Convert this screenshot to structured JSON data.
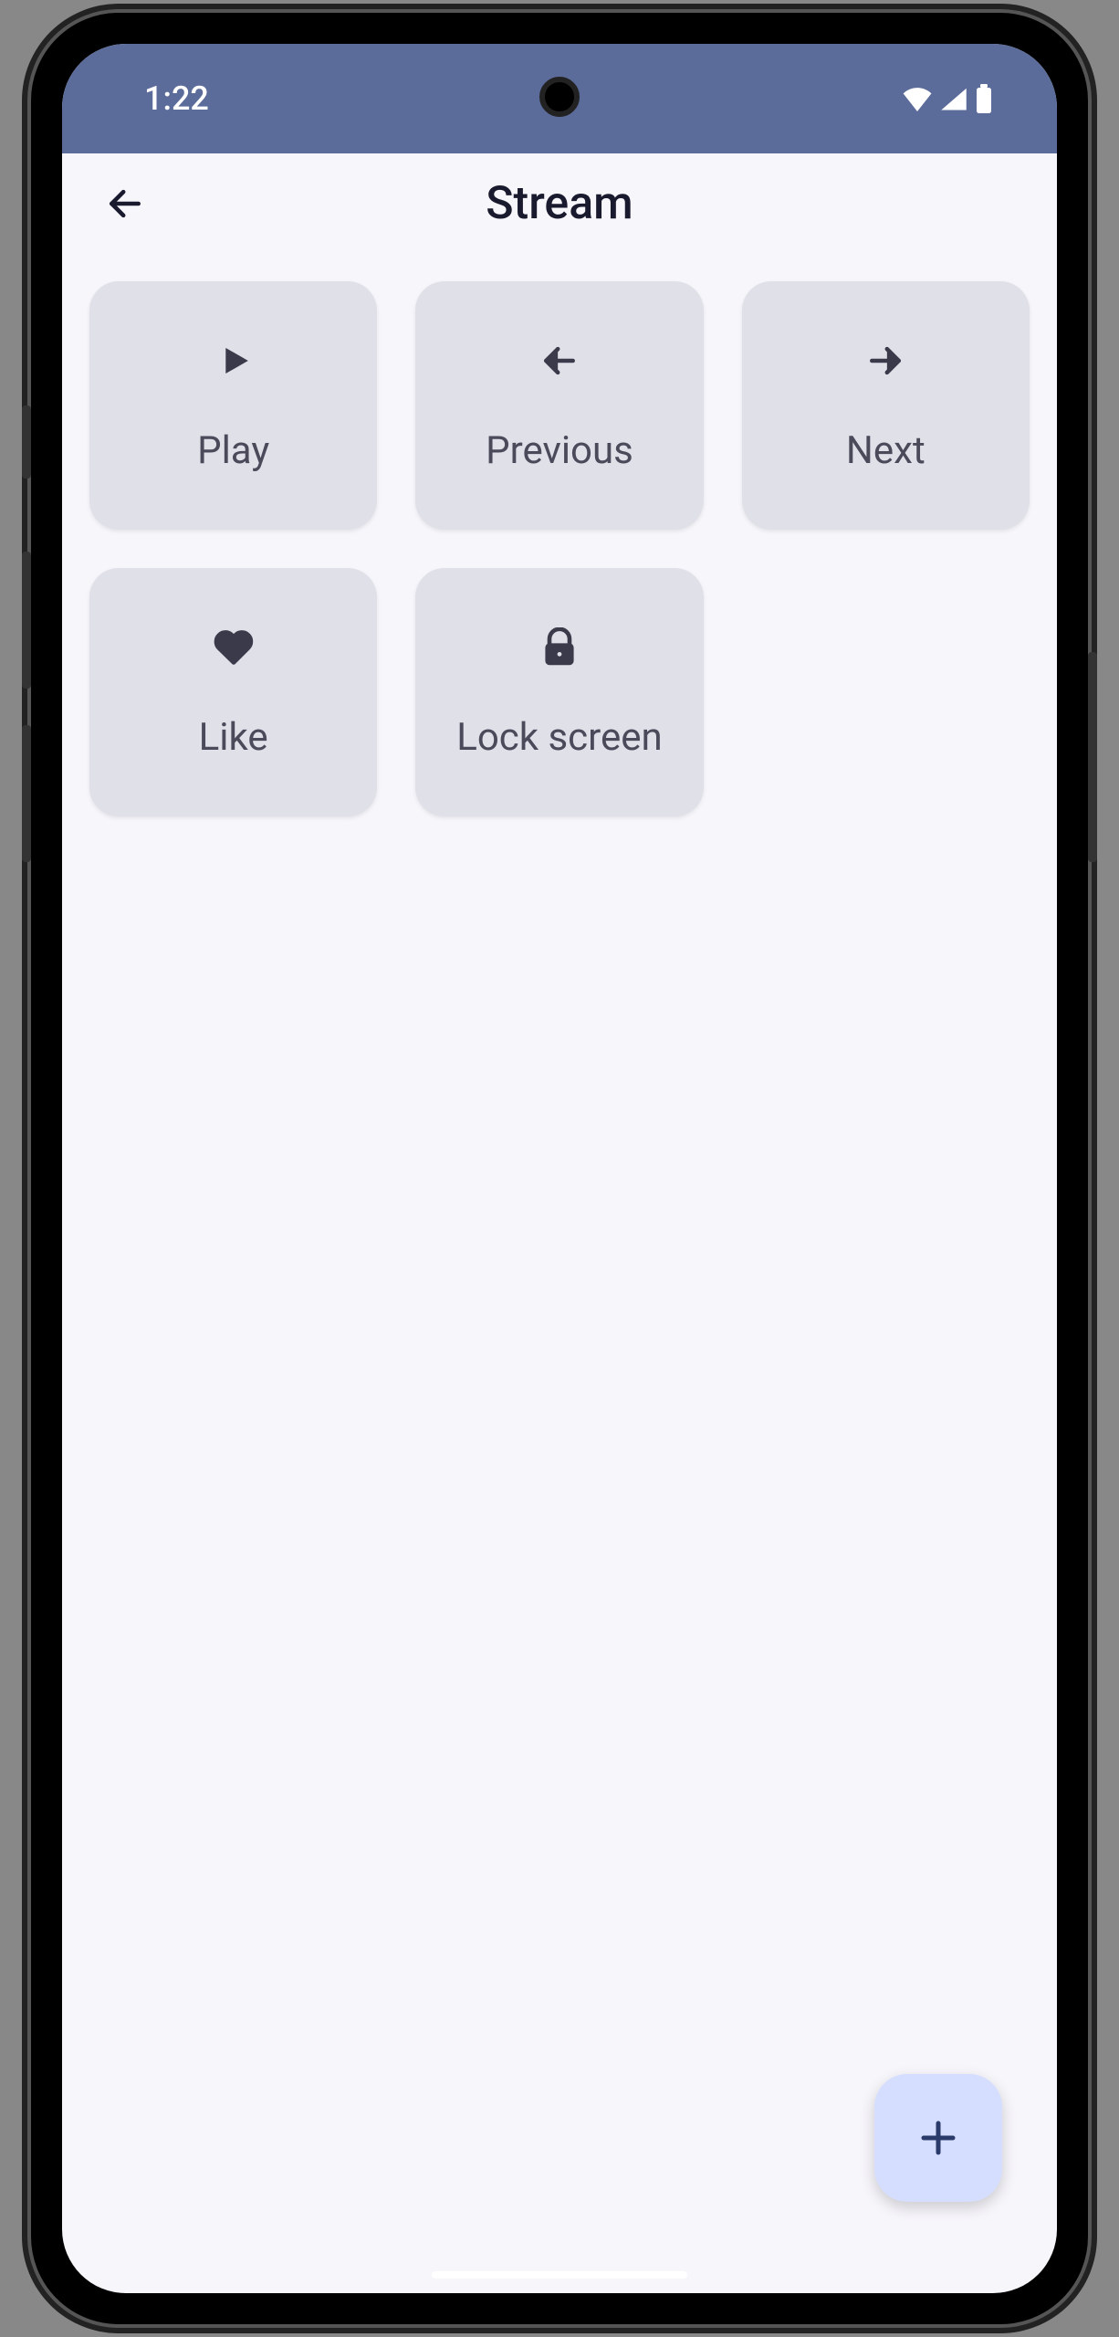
{
  "status": {
    "time": "1:22"
  },
  "header": {
    "title": "Stream"
  },
  "tiles": [
    {
      "label": "Play",
      "icon": "play-icon"
    },
    {
      "label": "Previous",
      "icon": "arrow-left-icon"
    },
    {
      "label": "Next",
      "icon": "arrow-right-icon"
    },
    {
      "label": "Like",
      "icon": "heart-icon"
    },
    {
      "label": "Lock screen",
      "icon": "lock-icon"
    }
  ],
  "colors": {
    "statusBar": "#5b6b9a",
    "background": "#f7f6fb",
    "tile": "#e0e0e9",
    "fab": "#d5deff",
    "text": "#3a3a4a"
  }
}
